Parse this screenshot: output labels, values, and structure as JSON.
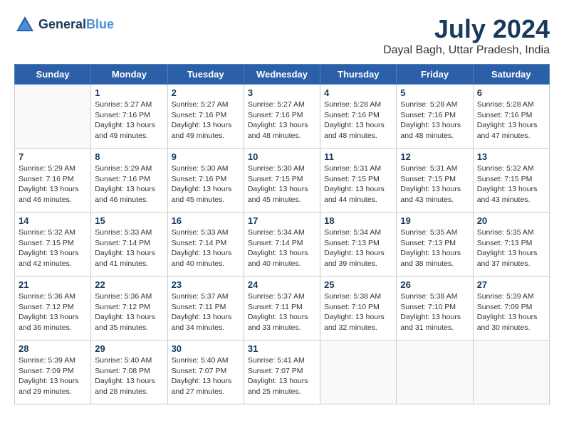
{
  "header": {
    "logo_line1": "General",
    "logo_line2": "Blue",
    "title": "July 2024",
    "subtitle": "Dayal Bagh, Uttar Pradesh, India"
  },
  "days_of_week": [
    "Sunday",
    "Monday",
    "Tuesday",
    "Wednesday",
    "Thursday",
    "Friday",
    "Saturday"
  ],
  "weeks": [
    [
      {
        "day": "",
        "info": ""
      },
      {
        "day": "1",
        "info": "Sunrise: 5:27 AM\nSunset: 7:16 PM\nDaylight: 13 hours\nand 49 minutes."
      },
      {
        "day": "2",
        "info": "Sunrise: 5:27 AM\nSunset: 7:16 PM\nDaylight: 13 hours\nand 49 minutes."
      },
      {
        "day": "3",
        "info": "Sunrise: 5:27 AM\nSunset: 7:16 PM\nDaylight: 13 hours\nand 48 minutes."
      },
      {
        "day": "4",
        "info": "Sunrise: 5:28 AM\nSunset: 7:16 PM\nDaylight: 13 hours\nand 48 minutes."
      },
      {
        "day": "5",
        "info": "Sunrise: 5:28 AM\nSunset: 7:16 PM\nDaylight: 13 hours\nand 48 minutes."
      },
      {
        "day": "6",
        "info": "Sunrise: 5:28 AM\nSunset: 7:16 PM\nDaylight: 13 hours\nand 47 minutes."
      }
    ],
    [
      {
        "day": "7",
        "info": "Sunrise: 5:29 AM\nSunset: 7:16 PM\nDaylight: 13 hours\nand 46 minutes."
      },
      {
        "day": "8",
        "info": "Sunrise: 5:29 AM\nSunset: 7:16 PM\nDaylight: 13 hours\nand 46 minutes."
      },
      {
        "day": "9",
        "info": "Sunrise: 5:30 AM\nSunset: 7:16 PM\nDaylight: 13 hours\nand 45 minutes."
      },
      {
        "day": "10",
        "info": "Sunrise: 5:30 AM\nSunset: 7:15 PM\nDaylight: 13 hours\nand 45 minutes."
      },
      {
        "day": "11",
        "info": "Sunrise: 5:31 AM\nSunset: 7:15 PM\nDaylight: 13 hours\nand 44 minutes."
      },
      {
        "day": "12",
        "info": "Sunrise: 5:31 AM\nSunset: 7:15 PM\nDaylight: 13 hours\nand 43 minutes."
      },
      {
        "day": "13",
        "info": "Sunrise: 5:32 AM\nSunset: 7:15 PM\nDaylight: 13 hours\nand 43 minutes."
      }
    ],
    [
      {
        "day": "14",
        "info": "Sunrise: 5:32 AM\nSunset: 7:15 PM\nDaylight: 13 hours\nand 42 minutes."
      },
      {
        "day": "15",
        "info": "Sunrise: 5:33 AM\nSunset: 7:14 PM\nDaylight: 13 hours\nand 41 minutes."
      },
      {
        "day": "16",
        "info": "Sunrise: 5:33 AM\nSunset: 7:14 PM\nDaylight: 13 hours\nand 40 minutes."
      },
      {
        "day": "17",
        "info": "Sunrise: 5:34 AM\nSunset: 7:14 PM\nDaylight: 13 hours\nand 40 minutes."
      },
      {
        "day": "18",
        "info": "Sunrise: 5:34 AM\nSunset: 7:13 PM\nDaylight: 13 hours\nand 39 minutes."
      },
      {
        "day": "19",
        "info": "Sunrise: 5:35 AM\nSunset: 7:13 PM\nDaylight: 13 hours\nand 38 minutes."
      },
      {
        "day": "20",
        "info": "Sunrise: 5:35 AM\nSunset: 7:13 PM\nDaylight: 13 hours\nand 37 minutes."
      }
    ],
    [
      {
        "day": "21",
        "info": "Sunrise: 5:36 AM\nSunset: 7:12 PM\nDaylight: 13 hours\nand 36 minutes."
      },
      {
        "day": "22",
        "info": "Sunrise: 5:36 AM\nSunset: 7:12 PM\nDaylight: 13 hours\nand 35 minutes."
      },
      {
        "day": "23",
        "info": "Sunrise: 5:37 AM\nSunset: 7:11 PM\nDaylight: 13 hours\nand 34 minutes."
      },
      {
        "day": "24",
        "info": "Sunrise: 5:37 AM\nSunset: 7:11 PM\nDaylight: 13 hours\nand 33 minutes."
      },
      {
        "day": "25",
        "info": "Sunrise: 5:38 AM\nSunset: 7:10 PM\nDaylight: 13 hours\nand 32 minutes."
      },
      {
        "day": "26",
        "info": "Sunrise: 5:38 AM\nSunset: 7:10 PM\nDaylight: 13 hours\nand 31 minutes."
      },
      {
        "day": "27",
        "info": "Sunrise: 5:39 AM\nSunset: 7:09 PM\nDaylight: 13 hours\nand 30 minutes."
      }
    ],
    [
      {
        "day": "28",
        "info": "Sunrise: 5:39 AM\nSunset: 7:09 PM\nDaylight: 13 hours\nand 29 minutes."
      },
      {
        "day": "29",
        "info": "Sunrise: 5:40 AM\nSunset: 7:08 PM\nDaylight: 13 hours\nand 28 minutes."
      },
      {
        "day": "30",
        "info": "Sunrise: 5:40 AM\nSunset: 7:07 PM\nDaylight: 13 hours\nand 27 minutes."
      },
      {
        "day": "31",
        "info": "Sunrise: 5:41 AM\nSunset: 7:07 PM\nDaylight: 13 hours\nand 25 minutes."
      },
      {
        "day": "",
        "info": ""
      },
      {
        "day": "",
        "info": ""
      },
      {
        "day": "",
        "info": ""
      }
    ]
  ]
}
